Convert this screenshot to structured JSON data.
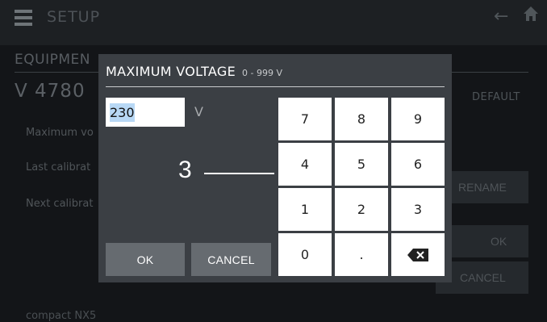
{
  "header": {
    "title": "SETUP",
    "icons": {
      "menu": "hamburger-icon",
      "back": "arrow-left-icon",
      "home": "home-icon"
    }
  },
  "background": {
    "equipment_label": "EQUIPMEN",
    "device_id": "V 4780",
    "default_label": "DEFAULT",
    "fields": [
      "Maximum vo",
      "Last calibrat",
      "Next calibrat"
    ],
    "rename_label": "RENAME",
    "ok_label": "OK",
    "cancel_label": "CANCEL",
    "device_name": "compact NX5"
  },
  "dialog": {
    "title": "MAXIMUM VOLTAGE",
    "range": "0 - 999 V",
    "input_value": "230",
    "unit": "V",
    "ok_label": "OK",
    "cancel_label": "CANCEL",
    "keys": [
      "7",
      "8",
      "9",
      "4",
      "5",
      "6",
      "1",
      "2",
      "3",
      "0",
      ".",
      "backspace"
    ]
  },
  "annotation": {
    "number": "3"
  },
  "colors": {
    "background": "#131518",
    "dialog": "#3b3f44",
    "dialog_button": "#666b70",
    "key": "#ffffff",
    "selection": "#b8d8f5"
  }
}
